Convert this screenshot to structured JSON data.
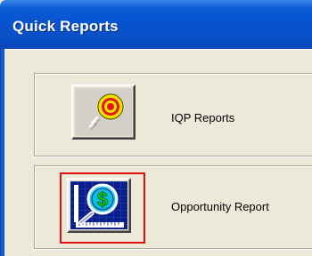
{
  "window": {
    "title": "Quick Reports"
  },
  "reports": [
    {
      "label": "IQP Reports",
      "icon": "target-icon"
    },
    {
      "label": "Opportunity Report",
      "icon": "magnifier-dollar-icon"
    }
  ],
  "colors": {
    "titlebar": "#0653cf",
    "selection_border": "#e01010",
    "window_bg": "#ece9d8"
  }
}
